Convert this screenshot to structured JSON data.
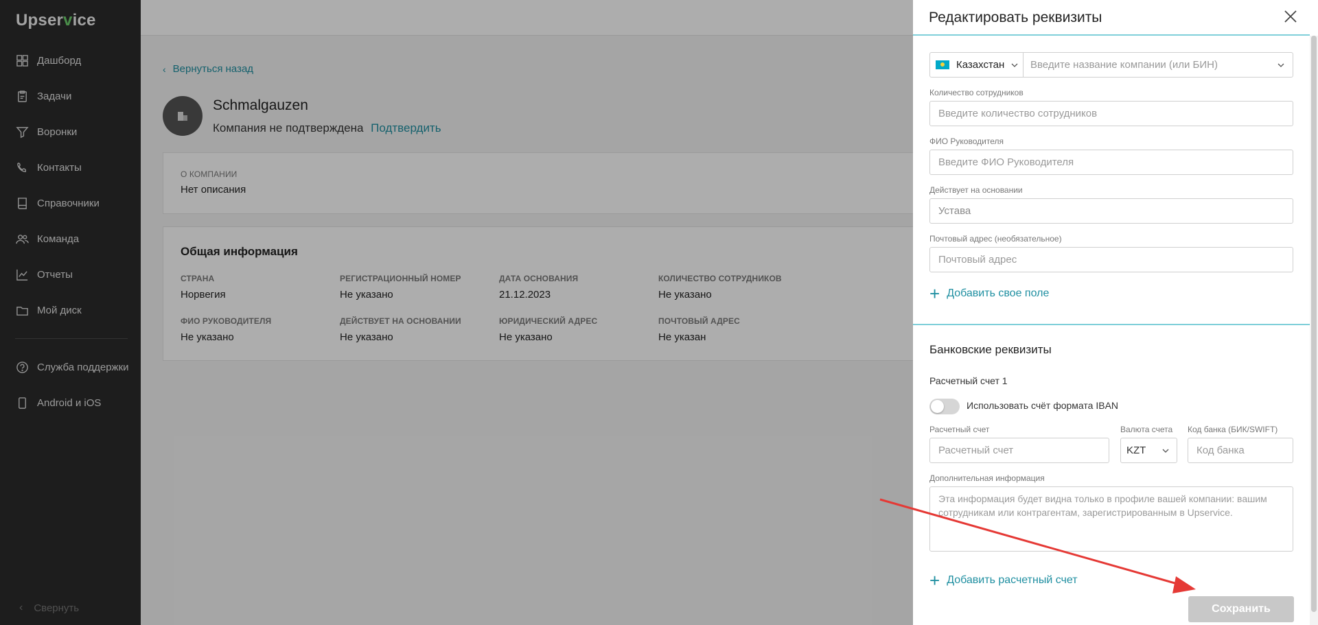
{
  "sidebar": {
    "logo_pre": "Upser",
    "logo_v": "v",
    "logo_post": "ice",
    "items": [
      {
        "label": "Дашборд",
        "icon": "dashboard-icon"
      },
      {
        "label": "Задачи",
        "icon": "tasks-icon"
      },
      {
        "label": "Воронки",
        "icon": "funnel-icon"
      },
      {
        "label": "Контакты",
        "icon": "contacts-icon"
      },
      {
        "label": "Справочники",
        "icon": "book-icon"
      },
      {
        "label": "Команда",
        "icon": "team-icon"
      },
      {
        "label": "Отчеты",
        "icon": "chart-icon"
      },
      {
        "label": "Мой диск",
        "icon": "folder-icon"
      }
    ],
    "support": {
      "label": "Служба поддержки",
      "icon": "help-icon"
    },
    "mobile": {
      "label": "Android и iOS",
      "icon": "phone-icon"
    },
    "collapse_label": "Свернуть"
  },
  "page": {
    "back_label": "Вернуться назад",
    "company_name": "Schmalgauzen",
    "status_text": "Компания не подтверждена",
    "confirm_label": "Подтвердить",
    "about": {
      "label": "О компании",
      "value": "Нет описания"
    },
    "general_title": "Общая информация",
    "fields": [
      {
        "label": "Страна",
        "value": "Норвегия"
      },
      {
        "label": "Регистрационный номер",
        "value": "Не указано"
      },
      {
        "label": "Дата основания",
        "value": "21.12.2023"
      },
      {
        "label": "Количество сотрудников",
        "value": "Не указано"
      },
      {
        "label": "ФИО руководителя",
        "value": "Не указано"
      },
      {
        "label": "Действует на основании",
        "value": "Не указано"
      },
      {
        "label": "Юридический адрес",
        "value": "Не указано"
      },
      {
        "label": "Почтовый адрес",
        "value": "Не указан"
      }
    ]
  },
  "drawer": {
    "title": "Редактировать реквизиты",
    "country": "Казахстан",
    "company_placeholder": "Введите название компании (или БИН)",
    "employees_label": "Количество сотрудников",
    "employees_placeholder": "Введите количество сотрудников",
    "director_label": "ФИО Руководителя",
    "director_placeholder": "Введите ФИО Руководителя",
    "basis_label": "Действует на основании",
    "basis_value": "Устава",
    "postal_label": "Почтовый адрес (необязательное)",
    "postal_placeholder": "Почтовый адрес",
    "add_field_label": "Добавить свое поле",
    "bank_title": "Банковские реквизиты",
    "account_title": "Расчетный счет 1",
    "iban_label": "Использовать счёт формата IBAN",
    "account_label": "Расчетный счет",
    "account_placeholder": "Расчетный счет",
    "currency_label": "Валюта счета",
    "currency_value": "KZT",
    "bank_code_label": "Код банка (БИК/SWIFT)",
    "bank_code_placeholder": "Код банка",
    "extra_label": "Дополнительная информация",
    "extra_placeholder": "Эта информация будет видна только в профиле вашей компании: вашим сотрудникам или контрагентам, зарегистрированным в Upservice.",
    "add_account_label": "Добавить расчетный счет",
    "save_label": "Сохранить"
  },
  "colors": {
    "accent": "#1f8fa1",
    "arrow": "#e53935",
    "sidebar": "#2b2b2b"
  }
}
